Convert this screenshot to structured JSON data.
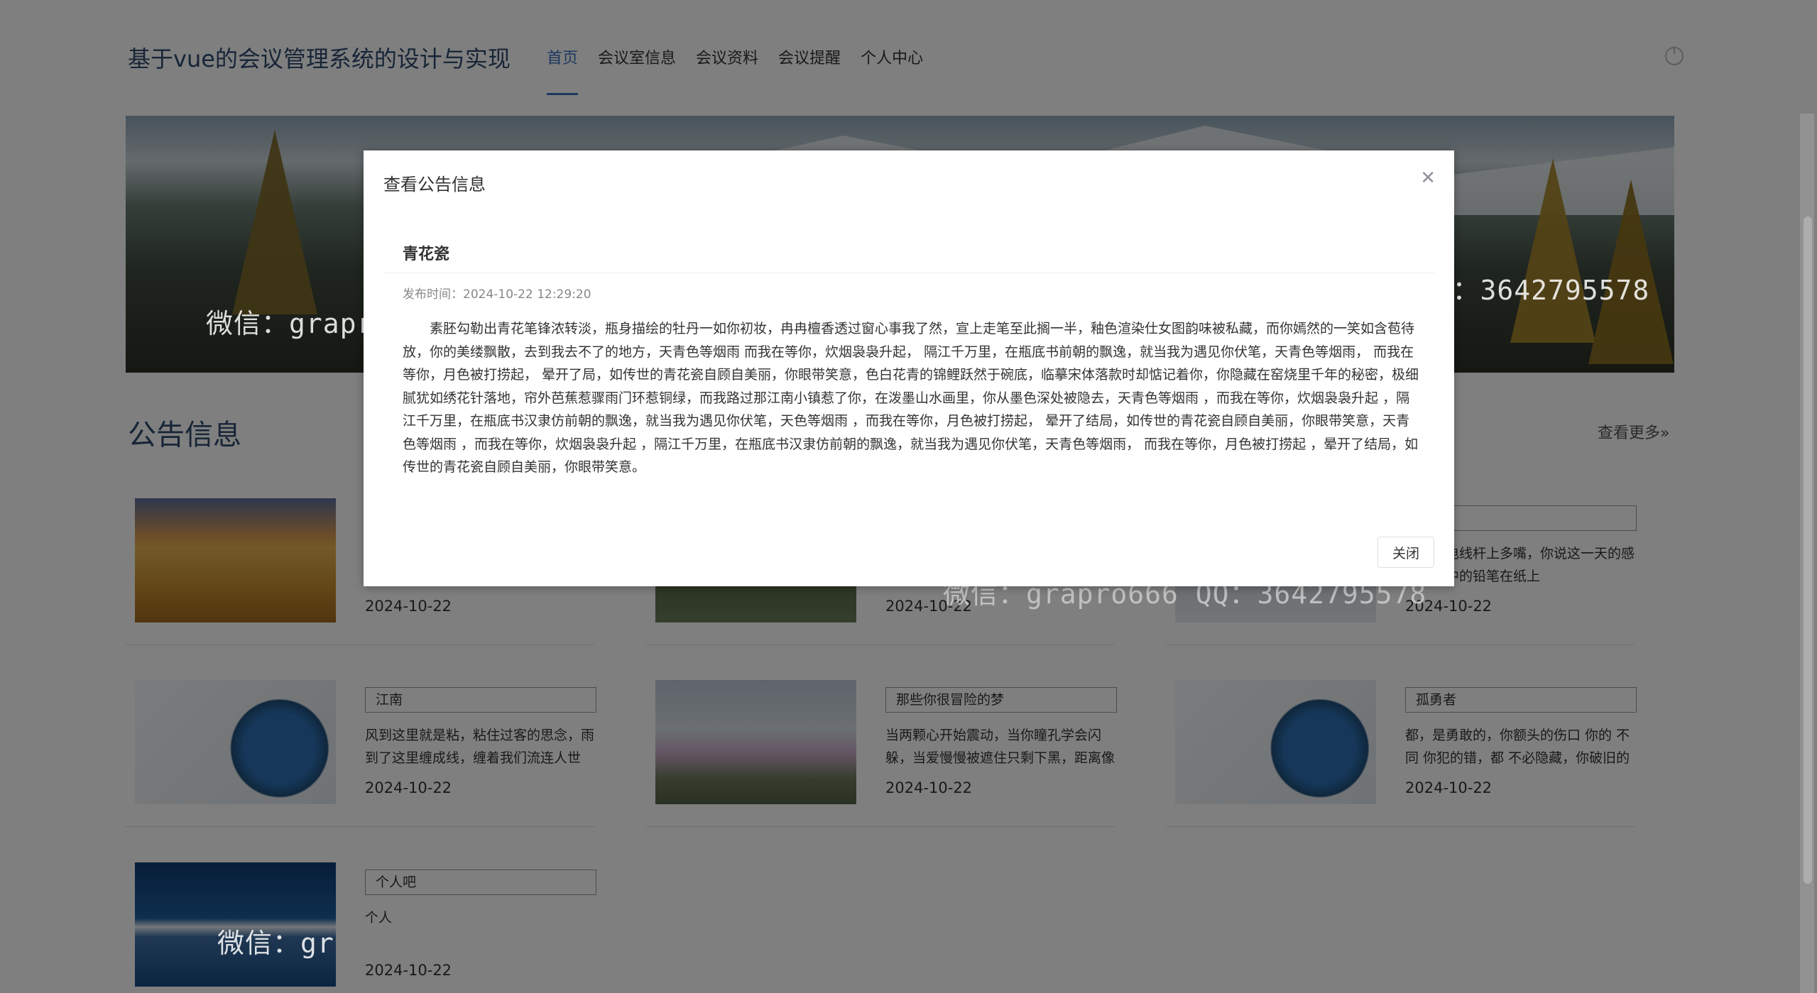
{
  "header": {
    "site_title": "基于vue的会议管理系统的设计与实现",
    "nav": [
      {
        "label": "首页",
        "active": true
      },
      {
        "label": "会议室信息"
      },
      {
        "label": "会议资料"
      },
      {
        "label": "会议提醒"
      },
      {
        "label": "个人中心"
      }
    ],
    "power_icon": "power-icon"
  },
  "section": {
    "title": "公告信息",
    "more": "查看更多»"
  },
  "watermarks": [
    "微信：grapro666 QQ：3642795578",
    "微信：grapro666 QQ：3642795578",
    "微信：grapro666 QQ：3642795578",
    "微信：gr"
  ],
  "cards": [
    {
      "title": "",
      "desc": "",
      "date": "2024-10-22",
      "image": "wheat-field"
    },
    {
      "title": "",
      "desc": "",
      "date": "2024-10-22",
      "image": "lake-reflection"
    },
    {
      "title": "",
      "desc": "麻雀在电线杆上多嘴，你说这一天的感觉，手中的铅笔在纸上",
      "date": "2024-10-22",
      "image": "snow-scene"
    },
    {
      "title": "江南",
      "desc": "风到这里就是粘，粘住过客的思念，雨到了这里缠成线，缠着我们流连人世",
      "date": "2024-10-22",
      "image": "earth-globe"
    },
    {
      "title": "那些你很冒险的梦",
      "desc": "当两颗心开始震动，当你瞳孔学会闪躲，当爱慢慢被遮住只剩下黑，距离像",
      "date": "2024-10-22",
      "image": "pagoda-sakura"
    },
    {
      "title": "孤勇者",
      "desc": "都，是勇敢的，你额头的伤口 你的 不同 你犯的错，都 不必隐藏，你破旧的",
      "date": "2024-10-22",
      "image": "earth-globe"
    },
    {
      "title": "个人吧",
      "desc": "个人",
      "date": "2024-10-22",
      "image": "mount-fuji"
    }
  ],
  "modal": {
    "title": "查看公告信息",
    "close_icon": "close-icon",
    "notice_title": "青花瓷",
    "publish_label": "发布时间：",
    "publish_time": "2024-10-22 12:29:20",
    "body": "素胚勾勒出青花笔锋浓转淡，瓶身描绘的牡丹一如你初妆，冉冉檀香透过窗心事我了然，宣上走笔至此搁一半，釉色渲染仕女图韵味被私藏，而你嫣然的一笑如含苞待放，你的美缕飘散，去到我去不了的地方，天青色等烟雨 而我在等你，炊烟袅袅升起， 隔江千万里，在瓶底书前朝的飘逸，就当我为遇见你伏笔，天青色等烟雨， 而我在等你，月色被打捞起， 晕开了局，如传世的青花瓷自顾自美丽，你眼带笑意，色白花青的锦鲤跃然于碗底，临摹宋体落款时却惦记着你，你隐藏在窑烧里千年的秘密，极细腻犹如绣花针落地，帘外芭蕉惹骤雨门环惹铜绿，而我路过那江南小镇惹了你，在泼墨山水画里，你从墨色深处被隐去，天青色等烟雨 ，而我在等你，炊烟袅袅升起 ，隔江千万里，在瓶底书汉隶仿前朝的飘逸，就当我为遇见你伏笔，天色等烟雨 ，而我在等你，月色被打捞起， 晕开了结局，如传世的青花瓷自顾自美丽，你眼带笑意，天青色等烟雨 ，而我在等你，炊烟袅袅升起 ，隔江千万里，在瓶底书汉隶仿前朝的飘逸，就当我为遇见你伏笔，天青色等烟雨， 而我在等你，月色被打捞起 ，晕开了结局，如传世的青花瓷自顾自美丽，你眼带笑意。",
    "close_button": "关闭"
  }
}
